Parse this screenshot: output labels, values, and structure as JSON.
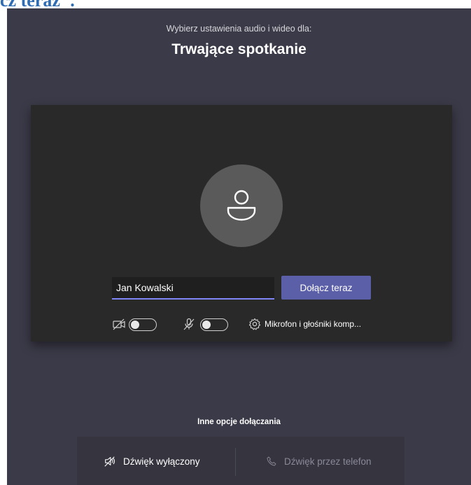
{
  "document": {
    "heading_fragment": "cz teraz\"."
  },
  "prejoin": {
    "subtitle": "Wybierz ustawienia audio i wideo dla:",
    "meeting_title": "Trwające spotkanie",
    "name_value": "Jan Kowalski",
    "join_label": "Dołącz teraz",
    "camera": {
      "icon": "camera-off-icon",
      "enabled": false
    },
    "microphone": {
      "icon": "mic-off-icon",
      "enabled": false
    },
    "device": {
      "icon": "gear-icon",
      "label": "Mikrofon i głośniki komp..."
    },
    "avatar_icon": "person-icon"
  },
  "other_options": {
    "title": "Inne opcje dołączania",
    "items": [
      {
        "label": "Dźwięk wyłączony",
        "icon": "speaker-off-icon",
        "enabled": true
      },
      {
        "label": "Dźwięk przez telefon",
        "icon": "phone-icon",
        "enabled": false
      }
    ]
  },
  "colors": {
    "background": "#3b3a48",
    "preview": "#292929",
    "accent": "#5b5fa8",
    "input_underline": "#7f85f5",
    "heading_blue": "#2f6cb4"
  }
}
